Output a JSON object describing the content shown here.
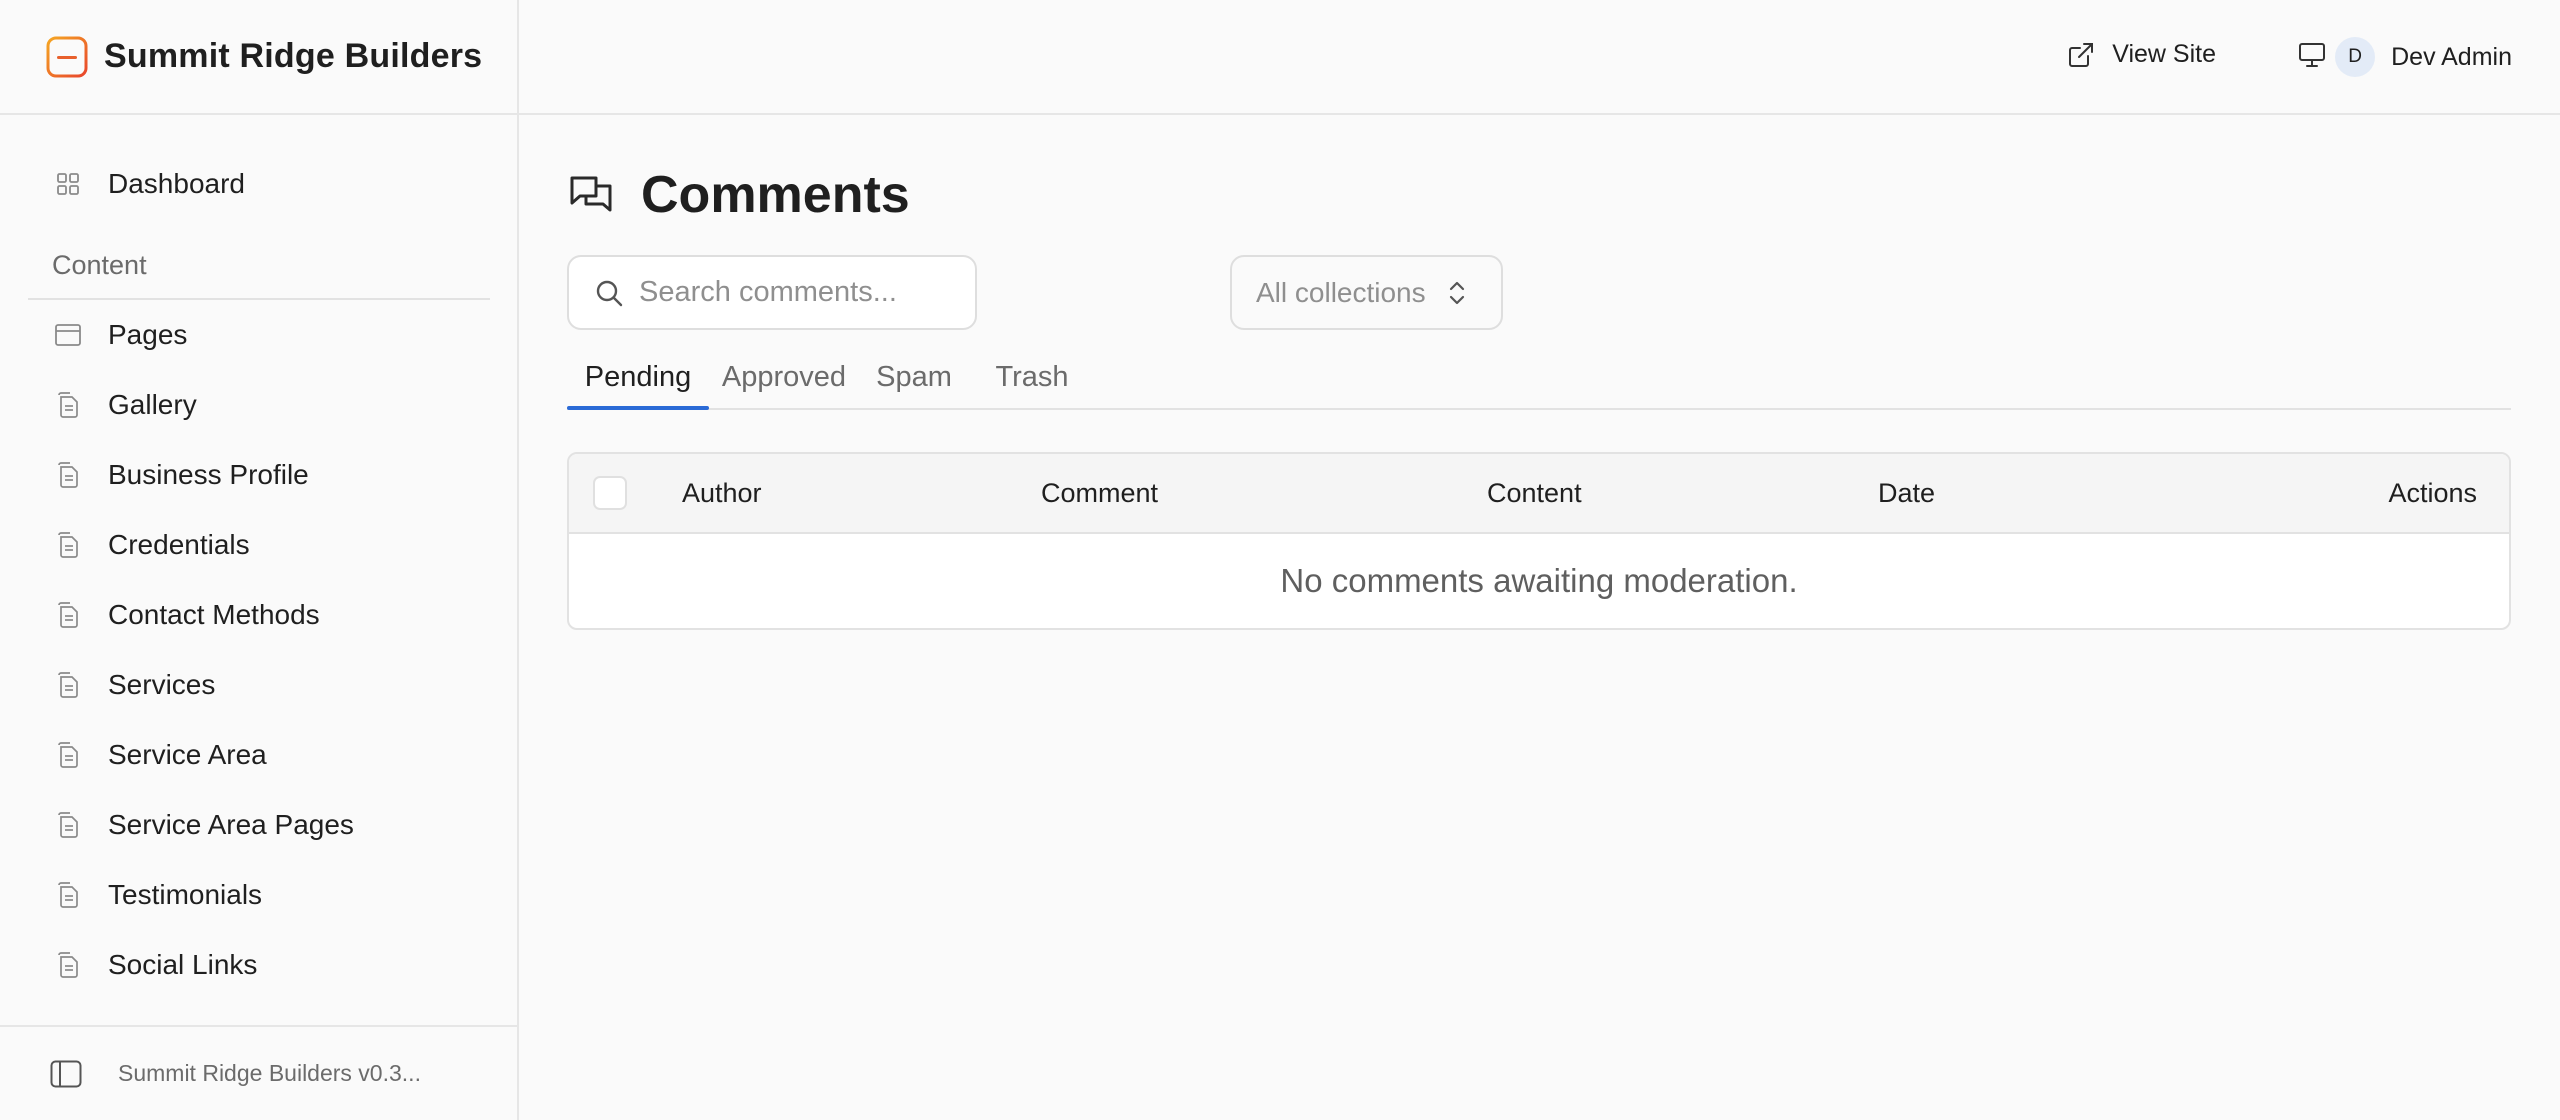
{
  "brand": {
    "name": "Summit Ridge Builders",
    "accent": "#f08a24"
  },
  "sidebar": {
    "dashboard": "Dashboard",
    "section_label": "Content",
    "items": [
      {
        "label": "Pages",
        "icon": "panel-icon"
      },
      {
        "label": "Gallery",
        "icon": "document-icon"
      },
      {
        "label": "Business Profile",
        "icon": "document-icon"
      },
      {
        "label": "Credentials",
        "icon": "document-icon"
      },
      {
        "label": "Contact Methods",
        "icon": "document-icon"
      },
      {
        "label": "Services",
        "icon": "document-icon"
      },
      {
        "label": "Service Area",
        "icon": "document-icon"
      },
      {
        "label": "Service Area Pages",
        "icon": "document-icon"
      },
      {
        "label": "Testimonials",
        "icon": "document-icon"
      },
      {
        "label": "Social Links",
        "icon": "document-icon"
      }
    ],
    "footer_version": "Summit Ridge Builders v0.3..."
  },
  "topbar": {
    "view_site": "View Site",
    "user_initial": "D",
    "user_name": "Dev Admin"
  },
  "main": {
    "title": "Comments",
    "search_placeholder": "Search comments...",
    "collection_select": "All collections",
    "tabs": [
      "Pending",
      "Approved",
      "Spam",
      "Trash"
    ],
    "active_tab": "Pending",
    "table": {
      "columns": [
        "Author",
        "Comment",
        "Content",
        "Date",
        "Actions"
      ],
      "empty_message": "No comments awaiting moderation."
    }
  },
  "colors": {
    "tab_active": "#2a6ad6",
    "avatar_bg": "#e3ebf7"
  }
}
